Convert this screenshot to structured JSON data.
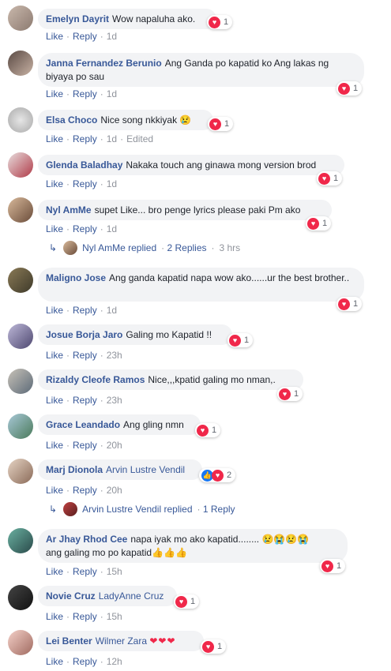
{
  "actions": {
    "like": "Like",
    "reply": "Reply",
    "sep": "·"
  },
  "comments": [
    {
      "name": "Emelyn Dayrit",
      "text": "Wow napaluha ako.",
      "time": "1d",
      "react_count": "1"
    },
    {
      "name": "Janna Fernandez Berunio",
      "text": "Ang Ganda po kapatid ko Ang lakas ng biyaya po sau",
      "time": "1d",
      "react_count": "1"
    },
    {
      "name": "Elsa Choco",
      "text": "Nice song nkkiyak",
      "emoji": "😢",
      "time": "1d",
      "edited": "Edited",
      "react_count": "1"
    },
    {
      "name": "Glenda Baladhay",
      "text": "Nakaka touch ang ginawa mong version brod",
      "time": "1d",
      "react_count": "1"
    },
    {
      "name": "Nyl AmMe",
      "text": "supet Like... bro penge lyrics please paki Pm ako",
      "time": "1d",
      "react_count": "1",
      "reply": {
        "author": "Nyl AmMe",
        "replied": "replied",
        "count": "2 Replies",
        "time": "3 hrs"
      }
    },
    {
      "name": "Maligno Jose",
      "text": "Ang ganda kapatid napa wow ako......ur the best brother..",
      "time": "1d",
      "react_count": "1"
    },
    {
      "name": "Josue Borja Jaro",
      "text": "Galing mo Kapatid !!",
      "time": "23h",
      "react_count": "1"
    },
    {
      "name": "Rizaldy Cleofe Ramos",
      "text": "Nice,,,kpatid galing mo nman,.",
      "time": "23h",
      "react_count": "1"
    },
    {
      "name": "Grace Leandado",
      "text": "Ang gling nmn",
      "time": "20h",
      "react_count": "1"
    },
    {
      "name": "Marj Dionola",
      "tag": "Arvin Lustre Vendil",
      "time": "20h",
      "react_count": "2",
      "reply": {
        "author": "Arvin Lustre Vendil",
        "replied": "replied",
        "count": "1 Reply"
      }
    },
    {
      "name": "Ar Jhay Rhod Cee",
      "text": "napa iyak mo ako kapatid........",
      "emoji": "😢😭😢😭",
      "text2": "ang galing mo po kapatid",
      "emoji2": "👍👍👍",
      "time": "15h",
      "react_count": "1"
    },
    {
      "name": "Novie Cruz",
      "tag": "LadyAnne Cruz",
      "time": "15h",
      "react_count": "1"
    },
    {
      "name": "Lei Benter",
      "tag": "Wilmer Zara",
      "emoji": "❤❤❤",
      "time": "12h",
      "react_count": "1"
    }
  ],
  "colors": {
    "name": "#385898",
    "bubble": "#f2f3f5",
    "meta": "#90949c",
    "heart": "#f0284a",
    "like": "#1877f2"
  },
  "icons": {
    "love": "heart-icon",
    "like": "thumbs-up-icon",
    "reply_arrow": "reply-arrow-icon"
  }
}
